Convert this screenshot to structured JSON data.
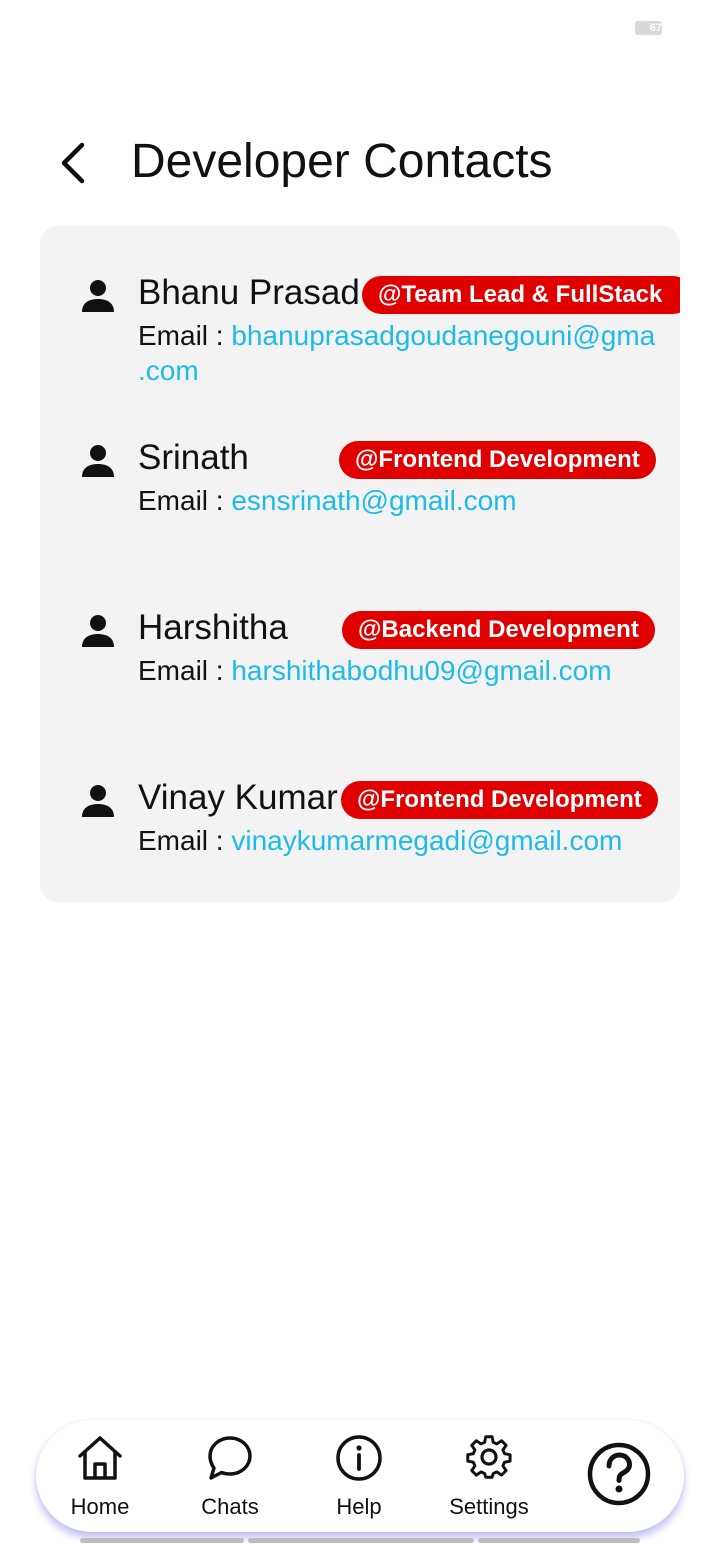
{
  "status_bar": {
    "battery": "67"
  },
  "header": {
    "title": "Developer Contacts"
  },
  "contacts": [
    {
      "name": "Bhanu Prasad",
      "role": "@Team Lead &  FullStack",
      "email_label": "Email :",
      "email": "bhanuprasadgoudanegouni@gmail.com",
      "email_line1": "bhanuprasadgoudanegouni@gma",
      "email_line2": ".com"
    },
    {
      "name": "Srinath",
      "role": "@Frontend Development",
      "email_label": "Email :",
      "email": "esnsrinath@gmail.com"
    },
    {
      "name": "Harshitha",
      "role": "@Backend Development",
      "email_label": "Email :",
      "email": "harshithabodhu09@gmail.com"
    },
    {
      "name": "Vinay Kumar",
      "role": "@Frontend Development",
      "email_label": "Email :",
      "email": "vinaykumarmegadi@gmail.com"
    }
  ],
  "bottom_nav": {
    "items": [
      {
        "label": "Home",
        "icon": "home-icon"
      },
      {
        "label": "Chats",
        "icon": "chat-bubble-icon"
      },
      {
        "label": "Help",
        "icon": "info-icon"
      },
      {
        "label": "Settings",
        "icon": "gear-icon"
      }
    ],
    "fab_icon": "question-mark-icon"
  },
  "colors": {
    "badge": "#e00000",
    "email_link": "#1ebbe6",
    "card_bg": "#f3f3f3",
    "nav_shadow": "#7878e6"
  }
}
